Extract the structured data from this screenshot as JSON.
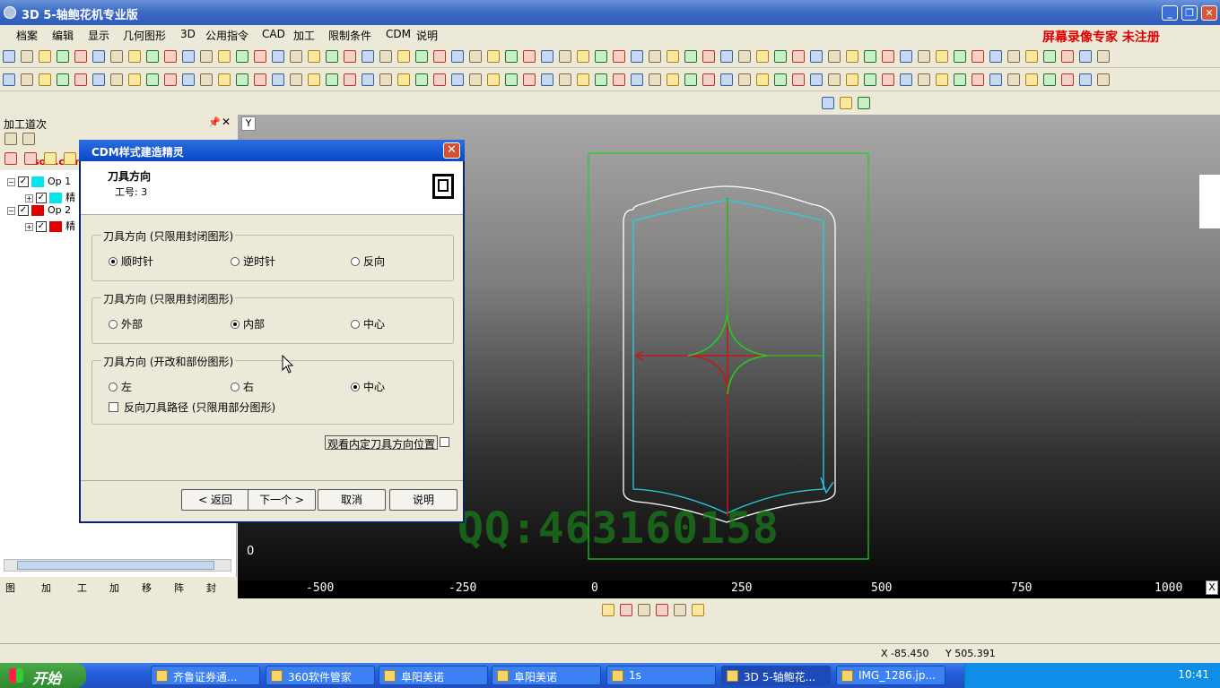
{
  "window": {
    "title": "3D 5-轴鲍花机专业版",
    "min": "_",
    "max": "❐",
    "close": "✕"
  },
  "menu": [
    "档案",
    "编辑",
    "显示",
    "几何图形",
    "3D",
    "公用指令",
    "CAD",
    "加工",
    "限制条件",
    "CDM",
    "说明"
  ],
  "recorder_watermark": "屏幕录像专家 未注册",
  "left_panel": {
    "title": "加工道次",
    "pin": "📌",
    "close": "✕",
    "site_watermark": "xsoft.com",
    "tree": [
      {
        "label": "Op 1",
        "color": "#00e5ee",
        "child_label": "精"
      },
      {
        "label": "Op 2",
        "color": "#e00000",
        "child_label": "精"
      }
    ],
    "tabs": [
      "图",
      "加",
      "工",
      "加",
      "移",
      "阵",
      "封"
    ]
  },
  "viewport": {
    "y_label": "Y",
    "zero_label": "0",
    "x_ticks": [
      "-500",
      "-250",
      "0",
      "250",
      "500",
      "750",
      "1000"
    ],
    "corner": "X"
  },
  "dialog": {
    "title": "CDM样式建造精灵",
    "close": "✕",
    "heading": "刀具方向",
    "subheading": "工号: 3",
    "group1": {
      "label": "刀具方向 (只限用封闭图形)",
      "options": [
        "顺时针",
        "逆时针",
        "反向"
      ],
      "selected": 0
    },
    "group2": {
      "label": "刀具方向 (只限用封闭图形)",
      "options": [
        "外部",
        "内部",
        "中心"
      ],
      "selected": 1
    },
    "group3": {
      "label": "刀具方向 (开改和部份图形)",
      "options": [
        "左",
        "右",
        "中心"
      ],
      "selected": 2,
      "reverse_label": "反向刀具路径 (只限用部分图形)"
    },
    "view_button": "观看内定刀具方向位置",
    "buttons": {
      "back": "< 返回",
      "next": "下一个 >",
      "cancel": "取消",
      "help": "说明"
    }
  },
  "qq_watermark": "QQ:463160158",
  "status": {
    "x": "X -85.450",
    "y": "Y 505.391"
  },
  "taskbar": {
    "start": "开始",
    "tasks": [
      "齐鲁证券通...",
      "360软件管家",
      "阜阳美诺",
      "阜阳美诺",
      "1s",
      "3D 5-轴鲍花...",
      "IMG_1286.jp..."
    ],
    "clock": "10:41"
  }
}
